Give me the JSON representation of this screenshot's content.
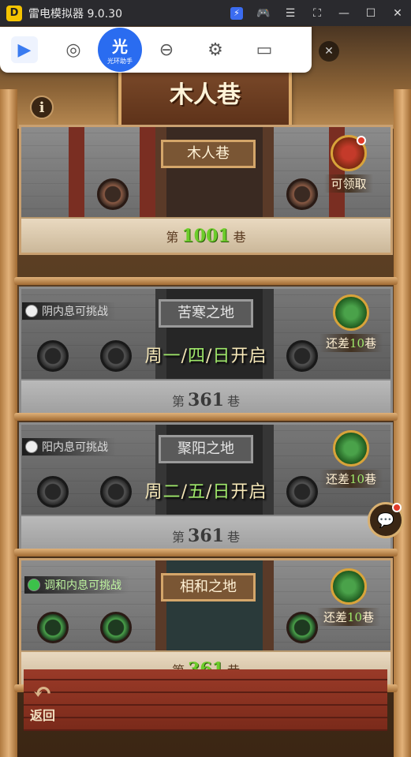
{
  "window": {
    "title": "雷电模拟器 9.0.30",
    "logo_glyph": "D",
    "controls": [
      "bolt-icon",
      "gamepad-icon",
      "menu-icon",
      "crop-icon",
      "minimize-icon",
      "maximize-icon",
      "close-icon"
    ]
  },
  "toolbar": {
    "logo_main": "光",
    "logo_sub": "光环助手"
  },
  "page": {
    "title": "木人巷",
    "info_glyph": "i",
    "back_label": "返回"
  },
  "cards": [
    {
      "name": "木人巷",
      "floor_prefix": "第",
      "floor_num": "1001",
      "floor_suffix": "巷",
      "reward_label": "可领取",
      "has_dot": true
    },
    {
      "name": "苦寒之地",
      "channel": "阴内息可挑战",
      "open": {
        "pre": "周",
        "d1": "一",
        "s1": "/",
        "d2": "四",
        "s2": "/",
        "d3": "日",
        "post": "开启"
      },
      "floor_prefix": "第",
      "floor_num": "361",
      "floor_suffix": "巷",
      "reward_pre": "还差",
      "reward_num": "10",
      "reward_post": "巷"
    },
    {
      "name": "聚阳之地",
      "channel": "阳内息可挑战",
      "open": {
        "pre": "周",
        "d1": "二",
        "s1": "/",
        "d2": "五",
        "s2": "/",
        "d3": "日",
        "post": "开启"
      },
      "floor_prefix": "第",
      "floor_num": "361",
      "floor_suffix": "巷",
      "reward_pre": "还差",
      "reward_num": "10",
      "reward_post": "巷"
    },
    {
      "name": "相和之地",
      "channel": "调和内息可挑战",
      "floor_prefix": "第",
      "floor_num": "361",
      "floor_suffix": "巷",
      "reward_pre": "还差",
      "reward_num": "10",
      "reward_post": "巷"
    }
  ]
}
